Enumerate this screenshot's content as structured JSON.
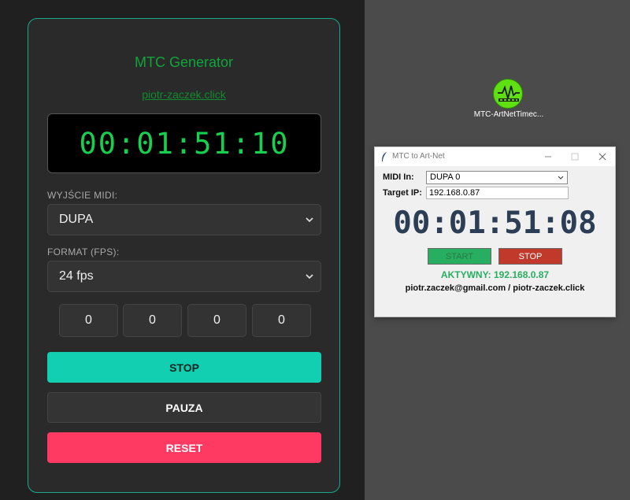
{
  "generator": {
    "title": "MTC Generator",
    "link": "piotr-zaczek.click",
    "timecode": "00:01:51:10",
    "midi_output_label": "WYJŚCIE MIDI:",
    "midi_output_value": "DUPA",
    "format_label": "FORMAT (FPS):",
    "format_value": "24 fps",
    "offsets": [
      "0",
      "0",
      "0",
      "0"
    ],
    "stop_label": "STOP",
    "pause_label": "PAUZA",
    "reset_label": "RESET",
    "colors": {
      "accent": "#11cfb0",
      "reset": "#ff3a62",
      "timecode": "#18d04f"
    }
  },
  "desktop_icon": {
    "label": "MTC-ArtNetTimec...",
    "icon": "waveform-icon"
  },
  "window": {
    "title": "MTC to Art-Net",
    "midi_in_label": "MIDI In:",
    "midi_in_value": "DUPA 0",
    "target_ip_label": "Target IP:",
    "target_ip_value": "192.168.0.87",
    "timecode": "00:01:51:08",
    "start_label": "START",
    "stop_label": "STOP",
    "status": "AKTYWNY: 192.168.0.87",
    "contact": "piotr.zaczek@gmail.com / piotr-zaczek.click",
    "colors": {
      "timecode": "#2c3e56",
      "start": "#27ae60",
      "stop": "#c0392b",
      "status": "#27ae60"
    }
  }
}
